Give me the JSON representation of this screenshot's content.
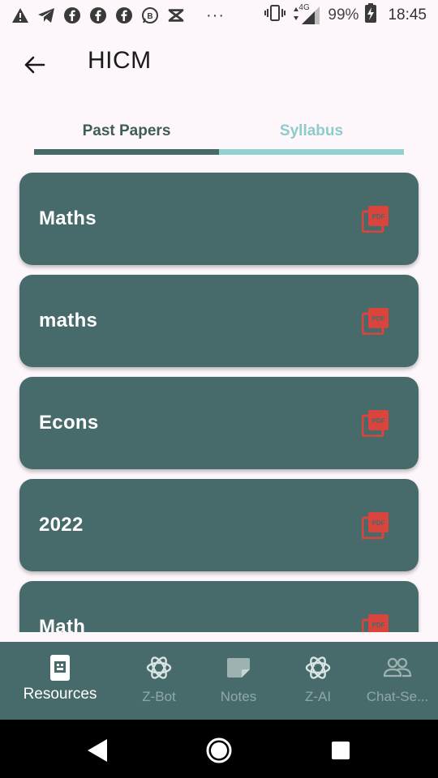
{
  "status_bar": {
    "battery_percent": "99%",
    "time": "18:45",
    "network": "4G",
    "dots": "···"
  },
  "app_bar": {
    "title": "HICM"
  },
  "tabs": [
    {
      "label": "Past Papers",
      "selected": true
    },
    {
      "label": "Syllabus",
      "selected": false
    }
  ],
  "papers": [
    {
      "label": "Maths",
      "icon": "pdf-icon"
    },
    {
      "label": "maths",
      "icon": "pdf-icon"
    },
    {
      "label": "Econs",
      "icon": "pdf-icon"
    },
    {
      "label": "2022",
      "icon": "pdf-icon"
    },
    {
      "label": "Math",
      "icon": "pdf-icon"
    }
  ],
  "bottom_nav": [
    {
      "label": "Resources",
      "icon": "resources-icon",
      "active": true
    },
    {
      "label": "Z-Bot",
      "icon": "openai-icon",
      "active": false
    },
    {
      "label": "Notes",
      "icon": "notes-icon",
      "active": false
    },
    {
      "label": "Z-AI",
      "icon": "openai-icon",
      "active": false
    },
    {
      "label": "Chat-Se...",
      "icon": "people-icon",
      "active": false
    }
  ],
  "colors": {
    "primary": "#476b6b",
    "tab_active": "#3e5c5a",
    "tab_inactive": "#8ccccb",
    "pdf_red": "#d9453d",
    "background": "#fdf7fb"
  }
}
